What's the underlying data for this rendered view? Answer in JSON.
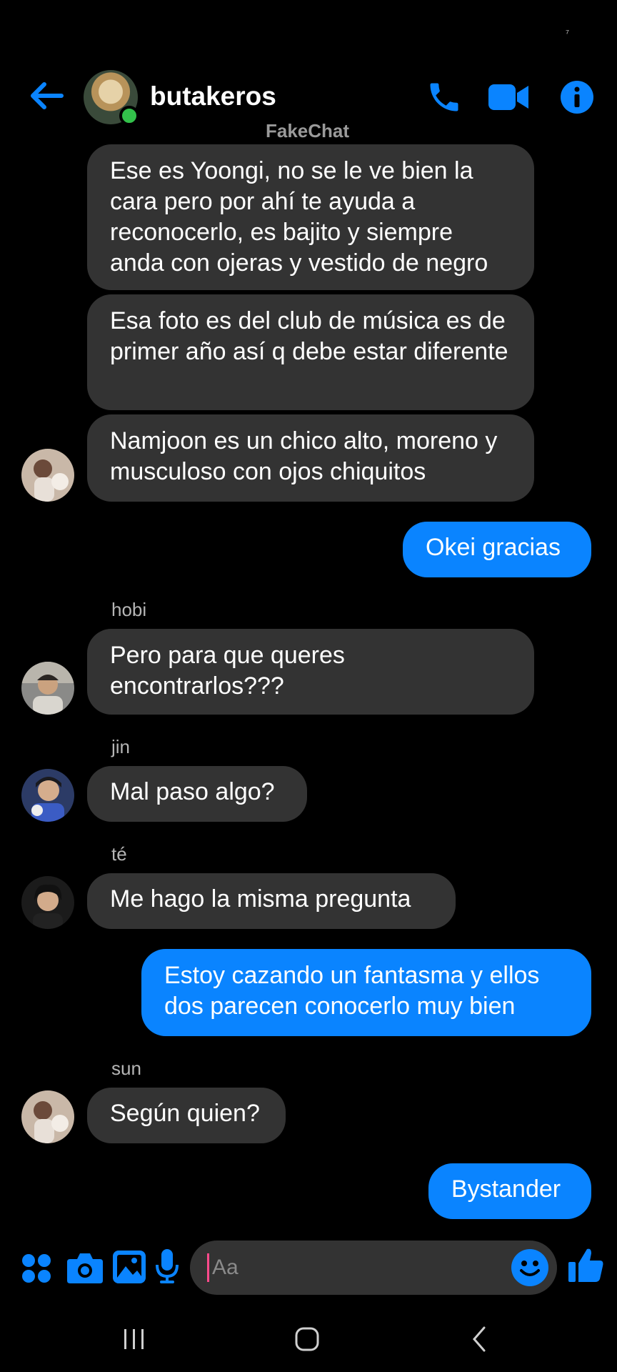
{
  "status": {
    "corner_mark": "⁷"
  },
  "header": {
    "title": "butakeros",
    "subtitle": "FakeChat",
    "icons": [
      "back-arrow-icon",
      "phone-icon",
      "video-camera-icon",
      "info-icon"
    ]
  },
  "colors": {
    "accent": "#0a84ff",
    "incoming": "#333333",
    "online": "#33c14b",
    "background": "#000000"
  },
  "messages": [
    {
      "dir": "in",
      "text": "Ese es Yoongi, no se le ve bien la cara pero por ahí te ayuda a reconocerlo, es bajito y siempre anda con ojeras y vestido de negro"
    },
    {
      "dir": "in",
      "text": "Esa foto es del club de música es de primer año así q debe estar diferente"
    },
    {
      "dir": "in",
      "text": "Namjoon es un chico alto, moreno y musculoso con ojos chiquitos"
    },
    {
      "dir": "out",
      "text": "Okei gracias"
    },
    {
      "dir": "in",
      "sender": "hobi",
      "text": "Pero para que queres encontrarlos???"
    },
    {
      "dir": "in",
      "sender": "jin",
      "text": "Mal paso algo?"
    },
    {
      "dir": "in",
      "sender": "té",
      "text": "Me hago la misma pregunta"
    },
    {
      "dir": "out",
      "text": "Estoy cazando un fantasma y ellos dos parecen conocerlo muy bien"
    },
    {
      "dir": "in",
      "sender": "sun",
      "text": "Según quien?"
    },
    {
      "dir": "out",
      "text": "Bystander"
    }
  ],
  "composer": {
    "placeholder": "Aa",
    "icons": [
      "apps-grid-icon",
      "camera-icon",
      "gallery-icon",
      "microphone-icon",
      "emoji-icon",
      "thumbs-up-icon"
    ]
  },
  "navbar": {
    "icons": [
      "recent-apps-icon",
      "home-icon",
      "back-icon"
    ]
  }
}
